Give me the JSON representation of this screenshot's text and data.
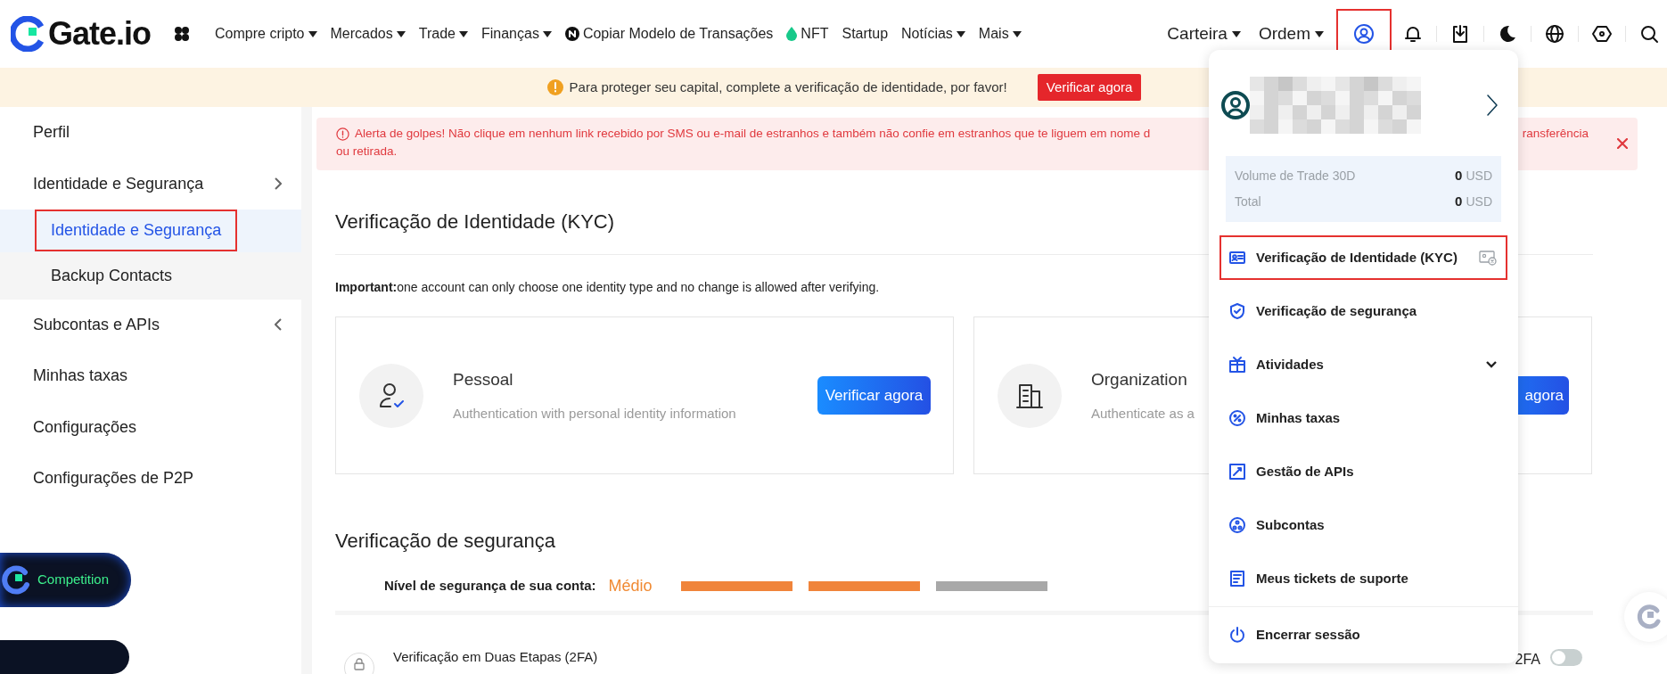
{
  "header": {
    "logo": "Gate.io",
    "nav": [
      {
        "label": "Compre cripto",
        "kind": "plain",
        "dropdown": true
      },
      {
        "label": "Mercados",
        "kind": "plain",
        "dropdown": true
      },
      {
        "label": "Trade",
        "kind": "plain",
        "dropdown": true
      },
      {
        "label": "Finanças",
        "kind": "plain",
        "dropdown": true
      },
      {
        "label": "Copiar Modelo de Transações",
        "kind": "badge",
        "dropdown": false
      },
      {
        "label": "NFT",
        "kind": "leaf",
        "dropdown": false
      },
      {
        "label": "Startup",
        "kind": "plain",
        "dropdown": false
      },
      {
        "label": "Notícias",
        "kind": "plain",
        "dropdown": true
      },
      {
        "label": "Mais",
        "kind": "plain",
        "dropdown": true
      }
    ],
    "right_menus": [
      {
        "label": "Carteira",
        "dropdown": true
      },
      {
        "label": "Ordem",
        "dropdown": true
      }
    ],
    "icons": [
      {
        "kind": "user",
        "highlighted": true
      },
      {
        "kind": "bell",
        "highlighted": false
      },
      {
        "kind": "download",
        "highlighted": false
      },
      {
        "kind": "moon",
        "highlighted": false
      },
      {
        "kind": "globe",
        "highlighted": false
      },
      {
        "kind": "hexagon",
        "highlighted": false
      },
      {
        "kind": "search",
        "highlighted": false
      }
    ]
  },
  "banner": {
    "message": "Para proteger seu capital, complete a verificação de identidade, por favor!",
    "button": "Verificar agora"
  },
  "sidebar": {
    "items": [
      {
        "label": "Perfil"
      },
      {
        "label": "Identidade e Segurança",
        "expanded": true,
        "children": [
          {
            "label": "Identidade e Segurança",
            "selected": true,
            "highlighted": true
          },
          {
            "label": "Backup Contacts",
            "selected": false,
            "highlighted": false
          }
        ]
      },
      {
        "label": "Subcontas e APIs",
        "expanded": false
      },
      {
        "label": "Minhas taxas"
      },
      {
        "label": "Configurações"
      },
      {
        "label": "Configurações de P2P"
      }
    ],
    "promos": [
      {
        "label": "Competition"
      }
    ]
  },
  "alert": {
    "line_1_start": "Alerta de golpes! Não clique em nenhum link recebido por SMS ou e-mail de estranhos e também não confie em estranhos que te liguem em nome d",
    "line_1_end": "ransferência",
    "line_2": "ou retirada."
  },
  "kyc": {
    "title": "Verificação de Identidade (KYC)",
    "note_label": "Important:",
    "note": "one account can only choose one identity type and no change is allowed after verifying.",
    "cards": [
      {
        "kind": "person",
        "title": "Pessoal",
        "description": "Authentication with personal identity information",
        "button": "Verificar agora"
      },
      {
        "kind": "organization",
        "title": "Organization",
        "description": "Authenticate as a",
        "button": "agora"
      }
    ]
  },
  "security": {
    "title": "Verificação de segurança",
    "level_label": "Nível de segurança de sua conta:",
    "level_value": "Médio",
    "segments": [
      {
        "filled": true
      },
      {
        "filled": true
      },
      {
        "filled": false
      }
    ],
    "rows": [
      {
        "title": "Verificação em Duas Etapas (2FA)",
        "toggle_label": "2FA",
        "on": false
      }
    ]
  },
  "dropdown": {
    "stats": [
      {
        "label": "Volume de Trade 30D",
        "value": "0",
        "unit": "USD"
      },
      {
        "label": "Total",
        "value": "0",
        "unit": "USD"
      }
    ],
    "items": [
      {
        "kind": "id-card",
        "label": "Verificação de Identidade (KYC)",
        "highlighted": true,
        "status_icon": true,
        "expandable": false,
        "separated": false
      },
      {
        "kind": "shield",
        "label": "Verificação de segurança",
        "highlighted": false,
        "status_icon": false,
        "expandable": false,
        "separated": false
      },
      {
        "kind": "gift",
        "label": "Atividades",
        "highlighted": false,
        "status_icon": false,
        "expandable": true,
        "separated": false
      },
      {
        "kind": "percent",
        "label": "Minhas taxas",
        "highlighted": false,
        "status_icon": false,
        "expandable": false,
        "separated": false
      },
      {
        "kind": "api",
        "label": "Gestão de APIs",
        "highlighted": false,
        "status_icon": false,
        "expandable": false,
        "separated": false
      },
      {
        "kind": "subaccounts",
        "label": "Subcontas",
        "highlighted": false,
        "status_icon": false,
        "expandable": false,
        "separated": false
      },
      {
        "kind": "ticket",
        "label": "Meus tickets de suporte",
        "highlighted": false,
        "status_icon": false,
        "expandable": false,
        "separated": false
      },
      {
        "kind": "power",
        "label": "Encerrar sessão",
        "highlighted": false,
        "status_icon": false,
        "expandable": false,
        "separated": true
      }
    ]
  }
}
